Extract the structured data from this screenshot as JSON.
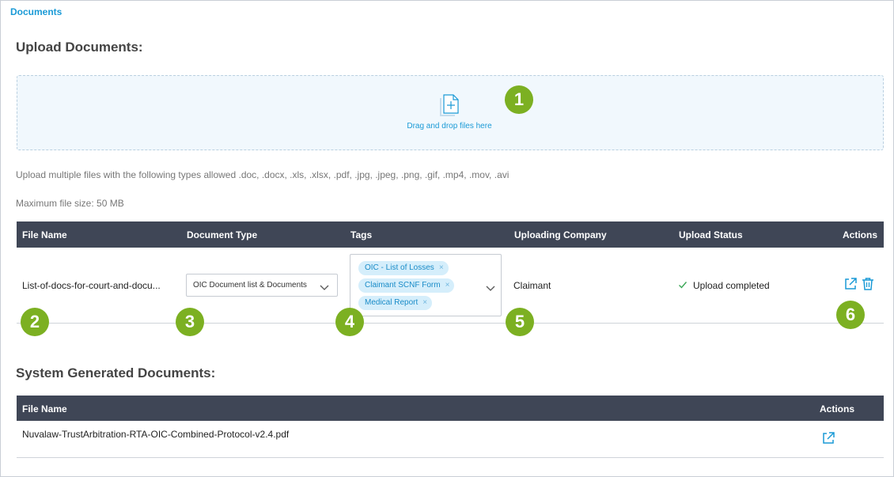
{
  "breadcrumb": "Documents",
  "upload": {
    "heading": "Upload Documents:",
    "dropzone_text": "Drag and drop files here",
    "allowed_types": "Upload multiple files with the following types allowed .doc, .docx, .xls, .xlsx, .pdf, .jpg, .jpeg, .png, .gif, .mp4, .mov, .avi",
    "max_size": "Maximum file size: 50 MB"
  },
  "upload_table": {
    "columns": [
      "File Name",
      "Document Type",
      "Tags",
      "Uploading Company",
      "Upload Status",
      "Actions"
    ],
    "rows": [
      {
        "file_name": "List-of-docs-for-court-and-docu...",
        "document_type": "OIC Document list & Documents",
        "tags": [
          "OIC - List of Losses",
          "Claimant SCNF Form",
          "Medical Report"
        ],
        "uploading_company": "Claimant",
        "upload_status": "Upload completed"
      }
    ]
  },
  "system_docs": {
    "heading": "System Generated Documents:",
    "columns": [
      "File Name",
      "Actions"
    ],
    "rows": [
      {
        "file_name": "Nuvalaw-TrustArbitration-RTA-OIC-Combined-Protocol-v2.4.pdf"
      }
    ]
  },
  "callouts": [
    "1",
    "2",
    "3",
    "4",
    "5",
    "6"
  ],
  "colors": {
    "accent": "#1a9ad6",
    "header_bg": "#3f4656",
    "callout": "#7cb022",
    "chip_bg": "#d5eefb",
    "success": "#3aa655"
  },
  "icons": [
    "file-add-icon",
    "chevron-down-icon",
    "close-icon",
    "check-icon",
    "open-external-icon",
    "trash-icon"
  ]
}
